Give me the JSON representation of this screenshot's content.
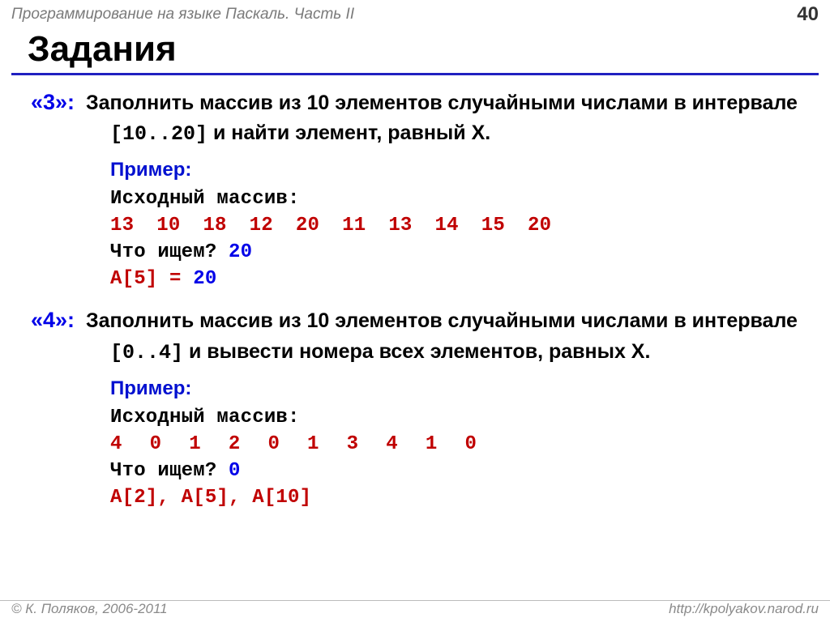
{
  "header": {
    "course": "Программирование на языке Паскаль. Часть II",
    "page": "40"
  },
  "title": "Задания",
  "t3": {
    "grade": "«3»:",
    "p1": "Заполнить массив из 10 элементов случайными числами в интервале ",
    "range": "[10..20]",
    "p2": " и найти элемент, равный X.",
    "example": "Пример:",
    "srclabel": "Исходный массив:",
    "arr": [
      "13",
      "10",
      "18",
      "12",
      "20",
      "11",
      "13",
      "14",
      "15",
      "20"
    ],
    "search_q": "Что ищем? ",
    "search_v": "20",
    "answer_l": "A[5] = ",
    "answer_v": "20"
  },
  "t4": {
    "grade": "«4»:",
    "p1": "Заполнить массив из 10 элементов случайными числами в интервале ",
    "range": "[0..4]",
    "p2": " и вывести номера всех элементов, равных X.",
    "example": "Пример:",
    "srclabel": "Исходный массив:",
    "arr": [
      "4",
      "0",
      "1",
      "2",
      "0",
      "1",
      "3",
      "4",
      "1",
      "0"
    ],
    "search_q": "Что ищем? ",
    "search_v": "0",
    "answer": "A[2], A[5], A[10]"
  },
  "footer": {
    "copy": "© К. Поляков, 2006-2011",
    "url": "http://kpolyakov.narod.ru"
  }
}
